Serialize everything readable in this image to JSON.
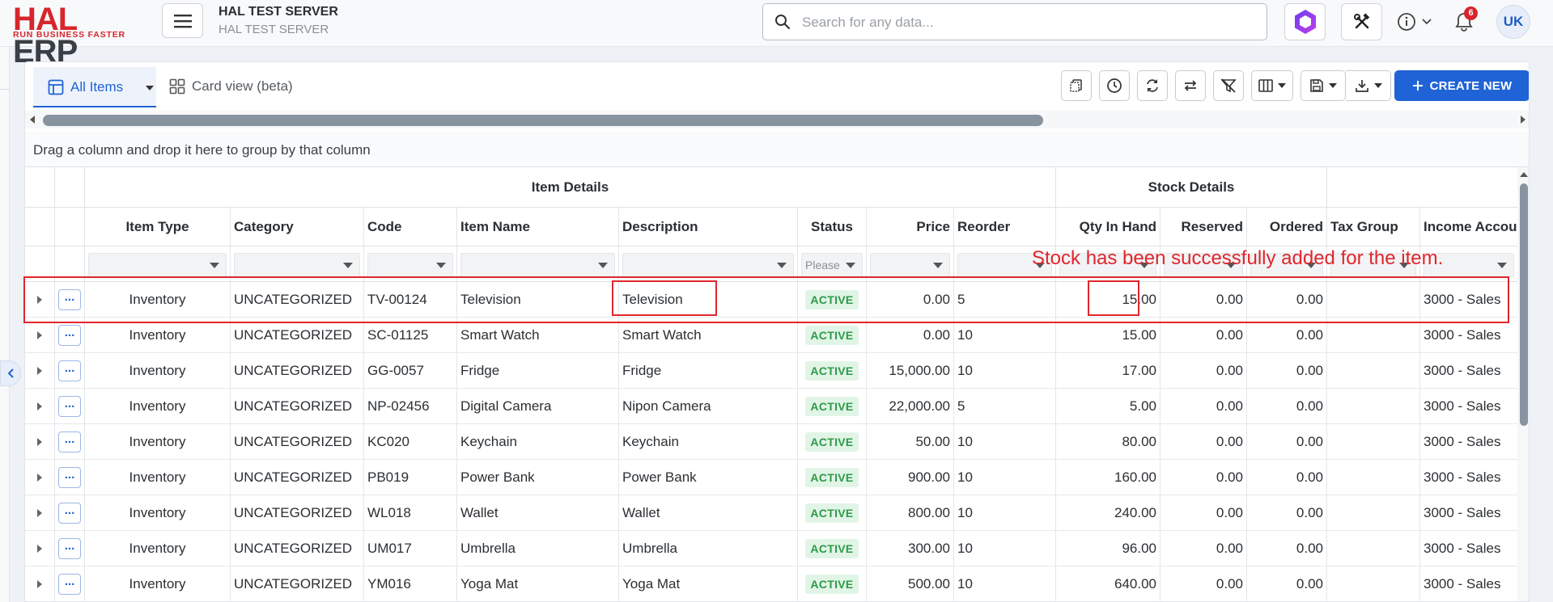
{
  "logo": {
    "brand_a": "HAL",
    "brand_b": "ERP",
    "tagline": "RUN BUSINESS FASTER"
  },
  "header": {
    "server_title": "HAL TEST SERVER",
    "server_subtitle": "HAL TEST SERVER",
    "search_placeholder": "Search for any data...",
    "notification_count": "6",
    "avatar_initials": "UK"
  },
  "tabs": {
    "all_items": "All Items",
    "card_view": "Card view (beta)"
  },
  "toolbar": {
    "create_new": "CREATE NEW"
  },
  "group_panel": "Drag a column and drop it here to group by that column",
  "bands": {
    "item_details": "Item Details",
    "stock_details": "Stock Details"
  },
  "columns": [
    "Item Type",
    "Category",
    "Code",
    "Item Name",
    "Description",
    "Status",
    "Price",
    "Reorder",
    "Qty In Hand",
    "Reserved",
    "Ordered",
    "Tax Group",
    "Income Account"
  ],
  "status_filter_placeholder": "Please",
  "rows": [
    {
      "type": "Inventory",
      "category": "UNCATEGORIZED",
      "code": "TV-00124",
      "name": "Television",
      "description": "Television",
      "status": "ACTIVE",
      "price": "0.00",
      "reorder": "5",
      "qty": "15.00",
      "reserved": "0.00",
      "ordered": "0.00",
      "tax": "",
      "income": "3000 - Sales"
    },
    {
      "type": "Inventory",
      "category": "UNCATEGORIZED",
      "code": "SC-01125",
      "name": "Smart Watch",
      "description": "Smart Watch",
      "status": "ACTIVE",
      "price": "0.00",
      "reorder": "10",
      "qty": "15.00",
      "reserved": "0.00",
      "ordered": "0.00",
      "tax": "",
      "income": "3000 - Sales"
    },
    {
      "type": "Inventory",
      "category": "UNCATEGORIZED",
      "code": "GG-0057",
      "name": "Fridge",
      "description": "Fridge",
      "status": "ACTIVE",
      "price": "15,000.00",
      "reorder": "10",
      "qty": "17.00",
      "reserved": "0.00",
      "ordered": "0.00",
      "tax": "",
      "income": "3000 - Sales"
    },
    {
      "type": "Inventory",
      "category": "UNCATEGORIZED",
      "code": "NP-02456",
      "name": "Digital Camera",
      "description": "Nipon Camera",
      "status": "ACTIVE",
      "price": "22,000.00",
      "reorder": "5",
      "qty": "5.00",
      "reserved": "0.00",
      "ordered": "0.00",
      "tax": "",
      "income": "3000 - Sales"
    },
    {
      "type": "Inventory",
      "category": "UNCATEGORIZED",
      "code": "KC020",
      "name": "Keychain",
      "description": "Keychain",
      "status": "ACTIVE",
      "price": "50.00",
      "reorder": "10",
      "qty": "80.00",
      "reserved": "0.00",
      "ordered": "0.00",
      "tax": "",
      "income": "3000 - Sales"
    },
    {
      "type": "Inventory",
      "category": "UNCATEGORIZED",
      "code": "PB019",
      "name": "Power Bank",
      "description": "Power Bank",
      "status": "ACTIVE",
      "price": "900.00",
      "reorder": "10",
      "qty": "160.00",
      "reserved": "0.00",
      "ordered": "0.00",
      "tax": "",
      "income": "3000 - Sales"
    },
    {
      "type": "Inventory",
      "category": "UNCATEGORIZED",
      "code": "WL018",
      "name": "Wallet",
      "description": "Wallet",
      "status": "ACTIVE",
      "price": "800.00",
      "reorder": "10",
      "qty": "240.00",
      "reserved": "0.00",
      "ordered": "0.00",
      "tax": "",
      "income": "3000 - Sales"
    },
    {
      "type": "Inventory",
      "category": "UNCATEGORIZED",
      "code": "UM017",
      "name": "Umbrella",
      "description": "Umbrella",
      "status": "ACTIVE",
      "price": "300.00",
      "reorder": "10",
      "qty": "96.00",
      "reserved": "0.00",
      "ordered": "0.00",
      "tax": "",
      "income": "3000 - Sales"
    },
    {
      "type": "Inventory",
      "category": "UNCATEGORIZED",
      "code": "YM016",
      "name": "Yoga Mat",
      "description": "Yoga Mat",
      "status": "ACTIVE",
      "price": "500.00",
      "reorder": "10",
      "qty": "640.00",
      "reserved": "0.00",
      "ordered": "0.00",
      "tax": "",
      "income": "3000 - Sales"
    }
  ],
  "annotation": {
    "message": "Stock has been successfully added for the item."
  },
  "colors": {
    "brand_red": "#d6262c",
    "primary_blue": "#1f63d6",
    "active_green": "#2e9a4a",
    "annotation_red": "#e0262c"
  }
}
